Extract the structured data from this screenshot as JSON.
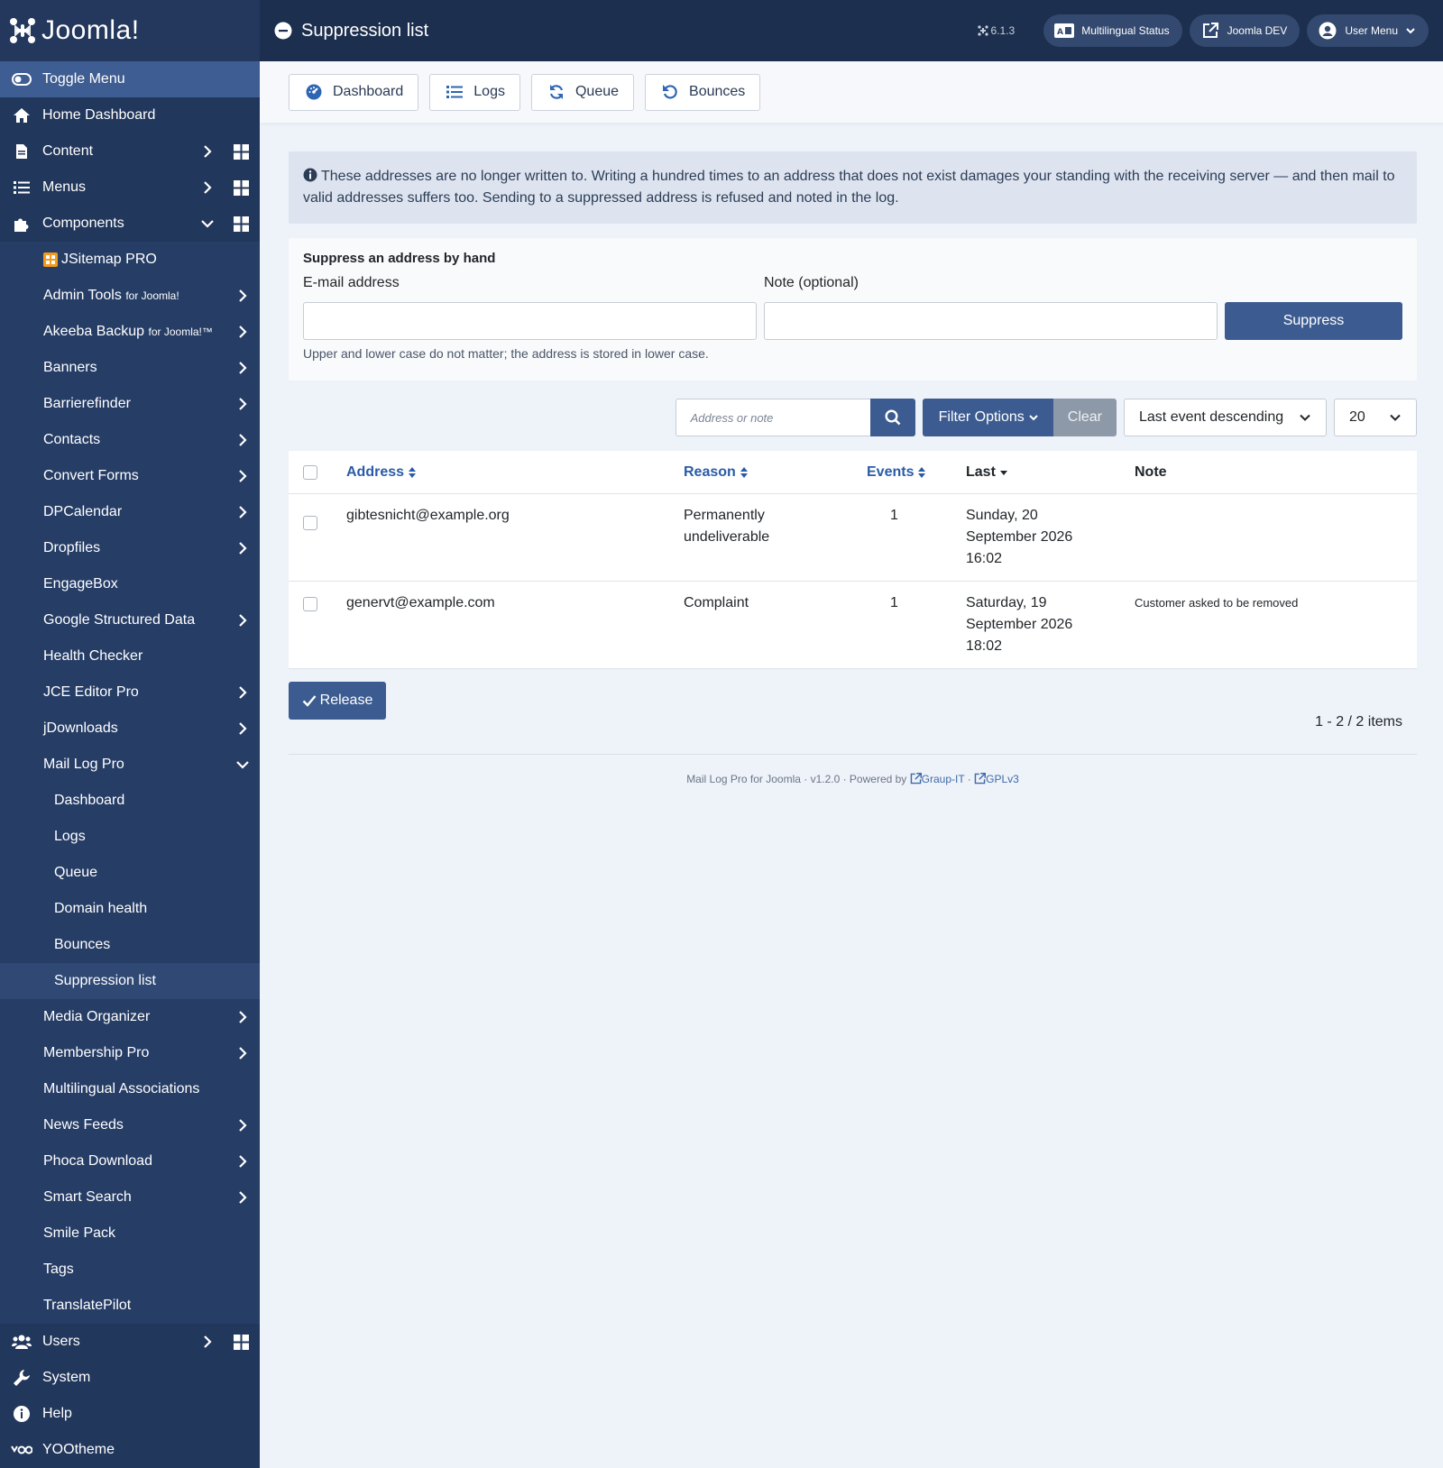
{
  "app": {
    "logo": "Joomla!",
    "version": "6.1.3",
    "page_title": "Suppression list",
    "top_buttons": {
      "multilingual": "Multilingual Status",
      "site": "Joomla DEV",
      "user": "User Menu"
    }
  },
  "sidebar": {
    "toggle": "Toggle Menu",
    "home": "Home Dashboard",
    "content": "Content",
    "menus": "Menus",
    "components": "Components",
    "component_items": [
      {
        "label": "JSitemap PRO",
        "small": ""
      },
      {
        "label": "Admin Tools",
        "small": "for Joomla!"
      },
      {
        "label": "Akeeba Backup",
        "small": "for Joomla!™"
      },
      {
        "label": "Banners",
        "small": ""
      },
      {
        "label": "Barrierefinder",
        "small": ""
      },
      {
        "label": "Contacts",
        "small": ""
      },
      {
        "label": "Convert Forms",
        "small": ""
      },
      {
        "label": "DPCalendar",
        "small": ""
      },
      {
        "label": "Dropfiles",
        "small": ""
      },
      {
        "label": "EngageBox",
        "small": ""
      },
      {
        "label": "Google Structured Data",
        "small": ""
      },
      {
        "label": "Health Checker",
        "small": ""
      },
      {
        "label": "JCE Editor Pro",
        "small": ""
      },
      {
        "label": "jDownloads",
        "small": ""
      },
      {
        "label": "Mail Log Pro",
        "small": ""
      }
    ],
    "maillog_items": [
      "Dashboard",
      "Logs",
      "Queue",
      "Domain health",
      "Bounces",
      "Suppression list"
    ],
    "component_items_after": [
      "Media Organizer",
      "Membership Pro",
      "Multilingual Associations",
      "News Feeds",
      "Phoca Download",
      "Smart Search",
      "Smile Pack",
      "Tags",
      "TranslatePilot"
    ],
    "users": "Users",
    "system": "System",
    "help": "Help",
    "yootheme": "YOOtheme"
  },
  "subnav": {
    "dashboard": "Dashboard",
    "logs": "Logs",
    "queue": "Queue",
    "bounces": "Bounces"
  },
  "alert": {
    "text": "These addresses are no longer written to. Writing a hundred times to an address that does not exist damages your standing with the receiving server — and then mail to valid addresses suffers too. Sending to a suppressed address is refused and noted in the log."
  },
  "form": {
    "title": "Suppress an address by hand",
    "email_label": "E-mail address",
    "email_value": "",
    "note_label": "Note (optional)",
    "note_value": "",
    "submit": "Suppress",
    "hint": "Upper and lower case do not matter; the address is stored in lower case."
  },
  "filters": {
    "search_placeholder": "Address or note",
    "filter_options": "Filter Options",
    "clear": "Clear",
    "ordering": "Last event descending",
    "limit": "20"
  },
  "table": {
    "headers": {
      "address": "Address",
      "reason": "Reason",
      "events": "Events",
      "last": "Last",
      "note": "Note"
    },
    "rows": [
      {
        "address": "gibtesnicht@example.org",
        "reason_1": "Permanently",
        "reason_2": "undeliverable",
        "events": "1",
        "last_1": "Sunday, 20",
        "last_2": "September 2026",
        "last_3": "16:02",
        "note": ""
      },
      {
        "address": "genervt@example.com",
        "reason_1": "Complaint",
        "reason_2": "",
        "events": "1",
        "last_1": "Saturday, 19",
        "last_2": "September 2026",
        "last_3": "18:02",
        "note": "Customer asked to be removed"
      }
    ]
  },
  "actions": {
    "release": "Release"
  },
  "pagination": {
    "summary": "1 - 2 / 2 items"
  },
  "footer": {
    "text": "Mail Log Pro for Joomla · v1.2.0 · Powered by",
    "link1": "Graup-IT",
    "sep": "·",
    "link2": "GPLv3"
  }
}
